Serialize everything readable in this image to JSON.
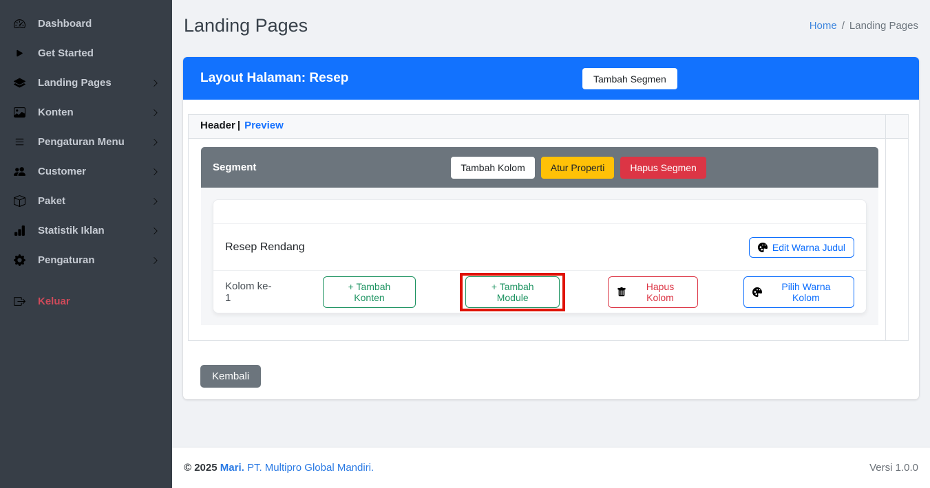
{
  "colors": {
    "primary_blue": "#1272fe",
    "link_blue": "#1873ff",
    "breadcrumb_link_blue": "#3e86de",
    "sidebar_bg": "#373e47",
    "sidebar_text": "#c6cbd3",
    "danger_red": "#dc3545",
    "warning_yellow": "#ffc107",
    "success_green": "#1d9361",
    "secondary_gray": "#6c757d",
    "annotation_red": "#e01205"
  },
  "sidebar": {
    "items": [
      {
        "label": "Dashboard",
        "icon": "speedometer-icon",
        "expandable": false
      },
      {
        "label": "Get Started",
        "icon": "play-icon",
        "expandable": false
      },
      {
        "label": "Landing Pages",
        "icon": "layers-icon",
        "expandable": true
      },
      {
        "label": "Konten",
        "icon": "image-icon",
        "expandable": true
      },
      {
        "label": "Pengaturan Menu",
        "icon": "menu-list-icon",
        "expandable": true
      },
      {
        "label": "Customer",
        "icon": "users-icon",
        "expandable": true
      },
      {
        "label": "Paket",
        "icon": "package-icon",
        "expandable": true
      },
      {
        "label": "Statistik Iklan",
        "icon": "bar-chart-icon",
        "expandable": true
      },
      {
        "label": "Pengaturan",
        "icon": "gear-icon",
        "expandable": true
      },
      {
        "label": "Keluar",
        "icon": "logout-icon",
        "expandable": false,
        "variant": "danger"
      }
    ]
  },
  "page_header": {
    "title": "Landing Pages",
    "breadcrumb_home": "Home",
    "breadcrumb_separator": "/",
    "breadcrumb_current": "Landing Pages"
  },
  "panel": {
    "header_title": "Layout Halaman: Resep",
    "add_segment_button": "Tambah Segmen",
    "tab_header": "Header",
    "tab_separator": "|",
    "tab_preview": "Preview",
    "segment": {
      "title": "Segment",
      "add_column_button": "Tambah Kolom",
      "set_properties_button": "Atur Properti",
      "delete_segment_button": "Hapus Segmen",
      "content_title": "Resep Rendang",
      "edit_title_color_button": "Edit Warna Judul",
      "column_label": "Kolom ke- 1",
      "add_content_button": "+ Tambah Konten",
      "add_module_button": "+ Tambah Module",
      "delete_column_button": "Hapus Kolom",
      "pick_column_color_button": "Pilih Warna Kolom"
    },
    "back_button": "Kembali"
  },
  "footer": {
    "copyright": "© 2025",
    "brand": "Mari.",
    "company": "PT. Multipro Global Mandiri.",
    "version": "Versi 1.0.0"
  }
}
